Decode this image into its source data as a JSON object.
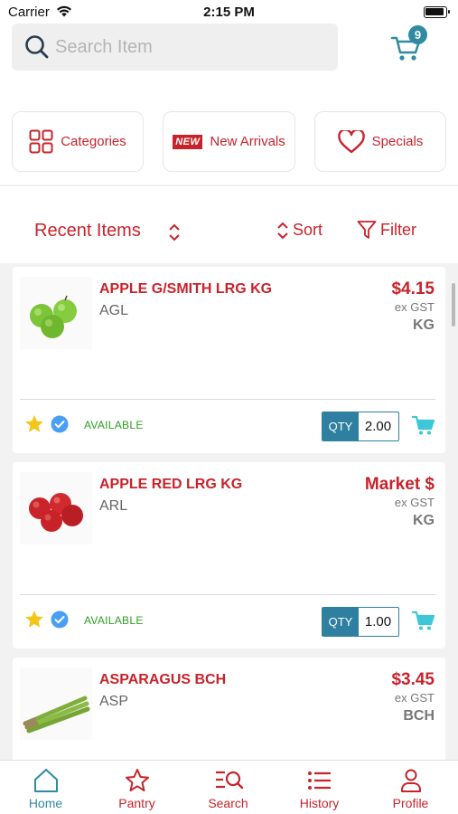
{
  "status_bar": {
    "carrier": "Carrier",
    "time": "2:15 PM"
  },
  "search": {
    "placeholder": "Search Item",
    "value": ""
  },
  "cart": {
    "count": "9"
  },
  "quick_nav": [
    {
      "label": "Categories",
      "icon": "grid-icon"
    },
    {
      "label": "New Arrivals",
      "icon": "new-badge-icon",
      "badge": "NEW"
    },
    {
      "label": "Specials",
      "icon": "heart-icon"
    }
  ],
  "list_header": {
    "title": "Recent Items",
    "sort_label": "Sort",
    "filter_label": "Filter"
  },
  "products": [
    {
      "name": "APPLE G/SMITH LRG KG",
      "code": "AGL",
      "price": "$4.15",
      "gst": "ex GST",
      "unit": "KG",
      "status": "AVAILABLE",
      "qty_label": "QTY",
      "qty": "2.00"
    },
    {
      "name": "APPLE RED LRG KG",
      "code": "ARL",
      "price": "Market $",
      "gst": "ex GST",
      "unit": "KG",
      "status": "AVAILABLE",
      "qty_label": "QTY",
      "qty": "1.00"
    },
    {
      "name": "ASPARAGUS BCH",
      "code": "ASP",
      "price": "$3.45",
      "gst": "ex GST",
      "unit": "BCH"
    }
  ],
  "tabs": [
    {
      "label": "Home",
      "icon": "home-icon",
      "active": true
    },
    {
      "label": "Pantry",
      "icon": "star-icon",
      "active": false
    },
    {
      "label": "Search",
      "icon": "search-list-icon",
      "active": false
    },
    {
      "label": "History",
      "icon": "list-icon",
      "active": false
    },
    {
      "label": "Profile",
      "icon": "person-icon",
      "active": false
    }
  ],
  "colors": {
    "brand_red": "#c8232b",
    "accent_teal": "#2f8aa2",
    "available_green": "#2e9c23"
  }
}
